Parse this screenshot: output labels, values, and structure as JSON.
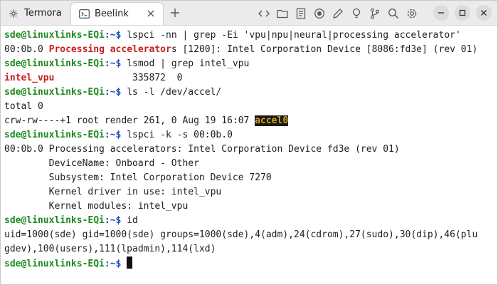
{
  "tabs": [
    {
      "label": "Termora",
      "icon": "gear-icon"
    },
    {
      "label": "Beelink",
      "icon": "terminal-icon"
    }
  ],
  "toolbar_icons": [
    "code-icon",
    "folder-icon",
    "document-icon",
    "record-icon",
    "pen-icon",
    "bulb-icon",
    "branch-icon",
    "search-icon",
    "settings-icon"
  ],
  "window_controls": [
    "minimize-icon",
    "maximize-icon",
    "close-icon"
  ],
  "terminal": {
    "prompt_user": "sde@linuxlinks-EQi",
    "prompt_path": ":~$",
    "cmd1": " lspci -nn | grep -Ei 'vpu|npu|neural|processing accelerator'",
    "out1_pre": "00:0b.0 ",
    "out1_hl": "Processing accelerator",
    "out1_post": "s [1200]: Intel Corporation Device [8086:fd3e] (rev 01)",
    "cmd2": " lsmod | grep intel_vpu",
    "out2_hl": "intel_vpu",
    "out2_post": "              335872  0",
    "cmd3": " ls -l /dev/accel/",
    "out3a": "total 0",
    "out3b_pre": "crw-rw----+1 root render 261, 0 Aug 19 16:07 ",
    "out3b_hl": "accel0",
    "cmd4": " lspci -k -s 00:0b.0",
    "out4a": "00:0b.0 Processing accelerators: Intel Corporation Device fd3e (rev 01)",
    "out4b": "        DeviceName: Onboard - Other",
    "out4c": "        Subsystem: Intel Corporation Device 7270",
    "out4d": "        Kernel driver in use: intel_vpu",
    "out4e": "        Kernel modules: intel_vpu",
    "cmd5": " id",
    "out5a": "uid=1000(sde) gid=1000(sde) groups=1000(sde),4(adm),24(cdrom),27(sudo),30(dip),46(plu",
    "out5b": "gdev),100(users),111(lpadmin),114(lxd)",
    "cmd6": " "
  }
}
